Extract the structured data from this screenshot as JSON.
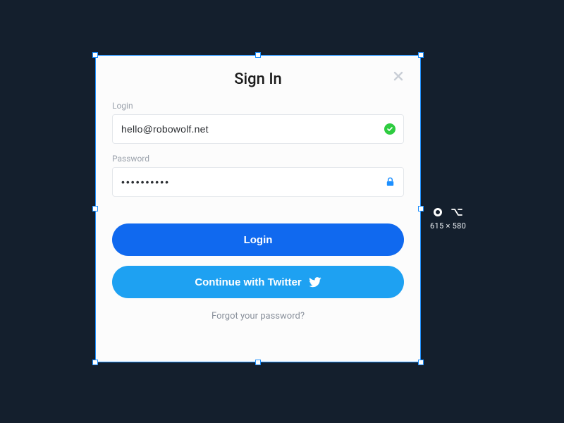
{
  "card": {
    "title": "Sign In",
    "login_label": "Login",
    "login_value": "hello@robowolf.net",
    "password_label": "Password",
    "password_value": "••••••••••",
    "login_button": "Login",
    "twitter_button": "Continue with Twitter",
    "forgot_link": "Forgot your password?"
  },
  "inspector": {
    "dimensions": "615 × 580"
  }
}
